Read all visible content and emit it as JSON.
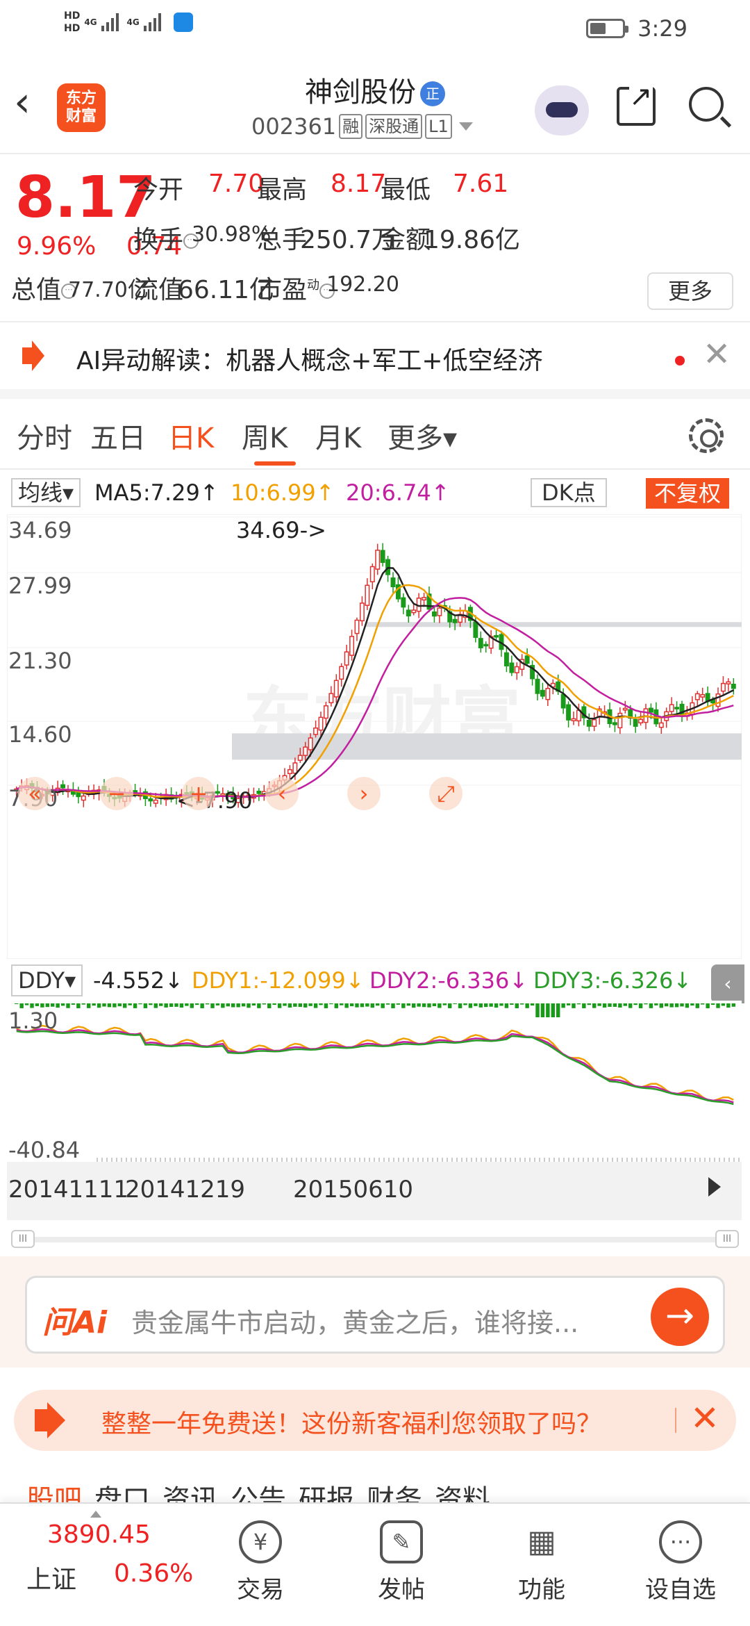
{
  "status_bar": {
    "time": "3:29",
    "hd1": "HD",
    "hd2": "HD",
    "net1": "4G",
    "net2": "4G"
  },
  "header": {
    "logo_line1": "东方",
    "logo_line2": "财富",
    "stock_name": "神剑股份",
    "name_badge": "正",
    "stock_code": "002361",
    "tag1": "融",
    "tag2": "深股通",
    "tag3": "L1"
  },
  "quote": {
    "price": "8.17",
    "change_pct": "9.96%",
    "change": "0.74",
    "open_label": "今开",
    "open": "7.70",
    "high_label": "最高",
    "high": "8.17",
    "low_label": "最低",
    "low": "7.61",
    "turnover_label": "换手",
    "turnover": "30.98%",
    "volume_label": "总手",
    "volume": "250.7万",
    "amount_label": "金额",
    "amount": "19.86亿",
    "mcap_label": "总值",
    "mcap": "77.70亿",
    "float_label": "流值",
    "float": "66.11亿",
    "pe_label": "市盈",
    "pe_sup": "动",
    "pe": "192.20",
    "more_label": "更多"
  },
  "ai_bar": {
    "text": "AI异动解读：机器人概念+军工+低空经济"
  },
  "tabs": [
    {
      "label": "分时"
    },
    {
      "label": "五日"
    },
    {
      "label": "日K"
    },
    {
      "label": "周K"
    },
    {
      "label": "月K"
    },
    {
      "label": "更多▾"
    }
  ],
  "ma": {
    "selector": "均线▾",
    "ma5": "MA5:7.29↑",
    "ma10": "10:6.99↑",
    "ma20": "20:6.74↑",
    "dk": "DK点",
    "fq": "不复权"
  },
  "kline": {
    "y_labels": [
      "34.69",
      "27.99",
      "21.30",
      "14.60",
      "7.90"
    ],
    "max_label": "34.69->",
    "min_label": "<-7.90",
    "watermark": "东方财富",
    "colors": {
      "up": "#e03030",
      "down": "#1a9a1a",
      "ma5": "#222222",
      "ma10": "#f0a000",
      "ma20": "#c21fa0",
      "band": "#d9dadd"
    }
  },
  "ddy": {
    "selector": "DDY▾",
    "ddy": "-4.552↓",
    "ddy1": "DDY1:-12.099↓",
    "ddy2": "DDY2:-6.336↓",
    "ddy3": "DDY3:-6.326↓",
    "y_top": "1.30",
    "y_bottom": "-40.84"
  },
  "dates": [
    "20141111",
    "20141219",
    "20150610"
  ],
  "wenai": {
    "logo": "问Ai",
    "placeholder": "贵金属牛市启动，黄金之后，谁将接..."
  },
  "promo": {
    "text": "整整一年免费送！这份新客福利您领取了吗？"
  },
  "subtabs": [
    "股吧",
    "盘口",
    "资讯",
    "公告",
    "研报",
    "财务",
    "资料"
  ],
  "bottom_nav": {
    "index_value": "3890.45",
    "index_name": "上证",
    "index_pct": "0.36%",
    "items": [
      {
        "label": "交易"
      },
      {
        "label": "发帖"
      },
      {
        "label": "功能"
      },
      {
        "label": "设自选"
      }
    ]
  }
}
